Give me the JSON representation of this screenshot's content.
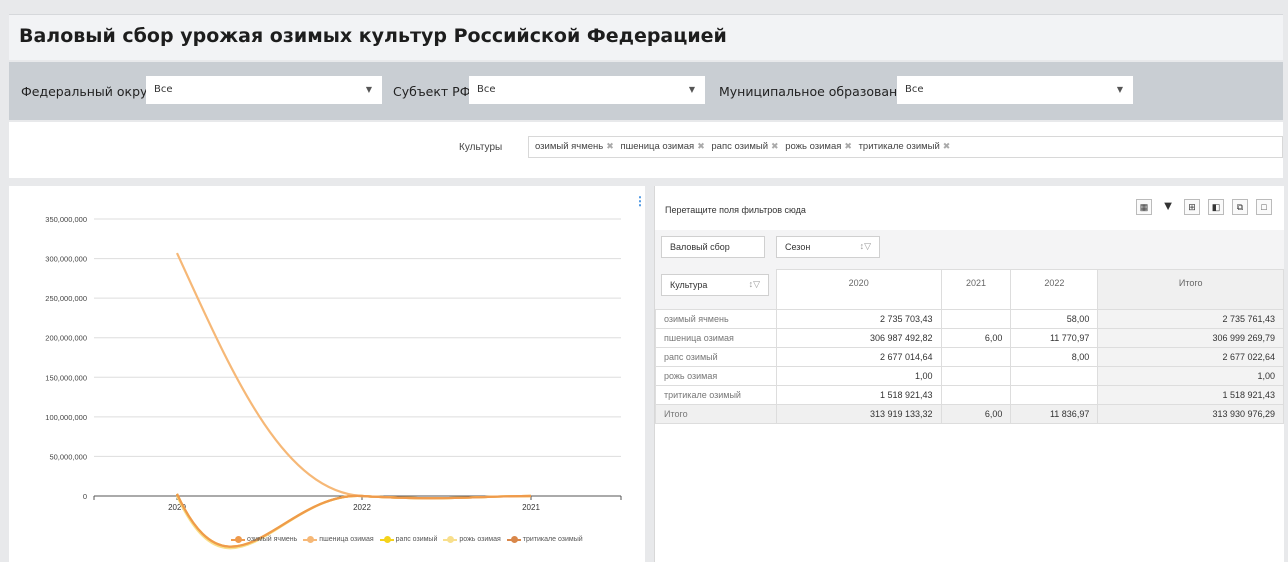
{
  "page_title": "Валовый сбор урожая озимых культур Российской Федерацией",
  "filters": {
    "federal_district": {
      "label": "Федеральный округ",
      "value": "Все"
    },
    "subject": {
      "label": "Субъект РФ",
      "value": "Все"
    },
    "municipal": {
      "label": "Муниципальное образование",
      "value": "Все"
    }
  },
  "cultures": {
    "label": "Культуры",
    "tags": [
      "озимый ячмень",
      "пшеница озимая",
      "рапс озимый",
      "рожь озимая",
      "тритикале озимый"
    ]
  },
  "chart_data": {
    "type": "line",
    "categories": [
      "2020",
      "2022",
      "2021"
    ],
    "ylim": [
      0,
      350000000
    ],
    "yticks": [
      "0",
      "50,000,000",
      "100,000,000",
      "150,000,000",
      "200,000,000",
      "250,000,000",
      "300,000,000",
      "350,000,000"
    ],
    "grid": true,
    "legend_position": "bottom",
    "series": [
      {
        "name": "озимый ячмень",
        "color": "#ef9a4c",
        "values": [
          2735703.43,
          58,
          0
        ]
      },
      {
        "name": "пшеница озимая",
        "color": "#f6b877",
        "values": [
          306987492.82,
          11770.97,
          6
        ]
      },
      {
        "name": "рапс озимый",
        "color": "#f5d31b",
        "values": [
          2677014.64,
          8,
          0
        ]
      },
      {
        "name": "рожь озимая",
        "color": "#f8df8c",
        "values": [
          1,
          0,
          0
        ]
      },
      {
        "name": "тритикале озимый",
        "color": "#d9874a",
        "values": [
          1518921.43,
          0,
          0
        ]
      }
    ]
  },
  "pivot": {
    "drop_hint": "Перетащите поля фильтров сюда",
    "toolbar_icons": [
      "fields-icon",
      "filter-icon",
      "format-icon",
      "options-icon",
      "export-icon",
      "fullscreen-icon"
    ],
    "measure": "Валовый сбор",
    "column_field": "Сезон",
    "row_field": "Культура",
    "columns": [
      "2020",
      "2021",
      "2022",
      "Итого"
    ],
    "rows": [
      {
        "label": "озимый ячмень",
        "cells": [
          "2 735 703,43",
          "",
          "58,00",
          "2 735 761,43"
        ]
      },
      {
        "label": "пшеница озимая",
        "cells": [
          "306 987 492,82",
          "6,00",
          "11 770,97",
          "306 999 269,79"
        ]
      },
      {
        "label": "рапс озимый",
        "cells": [
          "2 677 014,64",
          "",
          "8,00",
          "2 677 022,64"
        ]
      },
      {
        "label": "рожь озимая",
        "cells": [
          "1,00",
          "",
          "",
          "1,00"
        ]
      },
      {
        "label": "тритикале озимый",
        "cells": [
          "1 518 921,43",
          "",
          "",
          "1 518 921,43"
        ]
      },
      {
        "label": "Итого",
        "cells": [
          "313 919 133,32",
          "6,00",
          "11 836,97",
          "313 930 976,29"
        ]
      }
    ]
  }
}
